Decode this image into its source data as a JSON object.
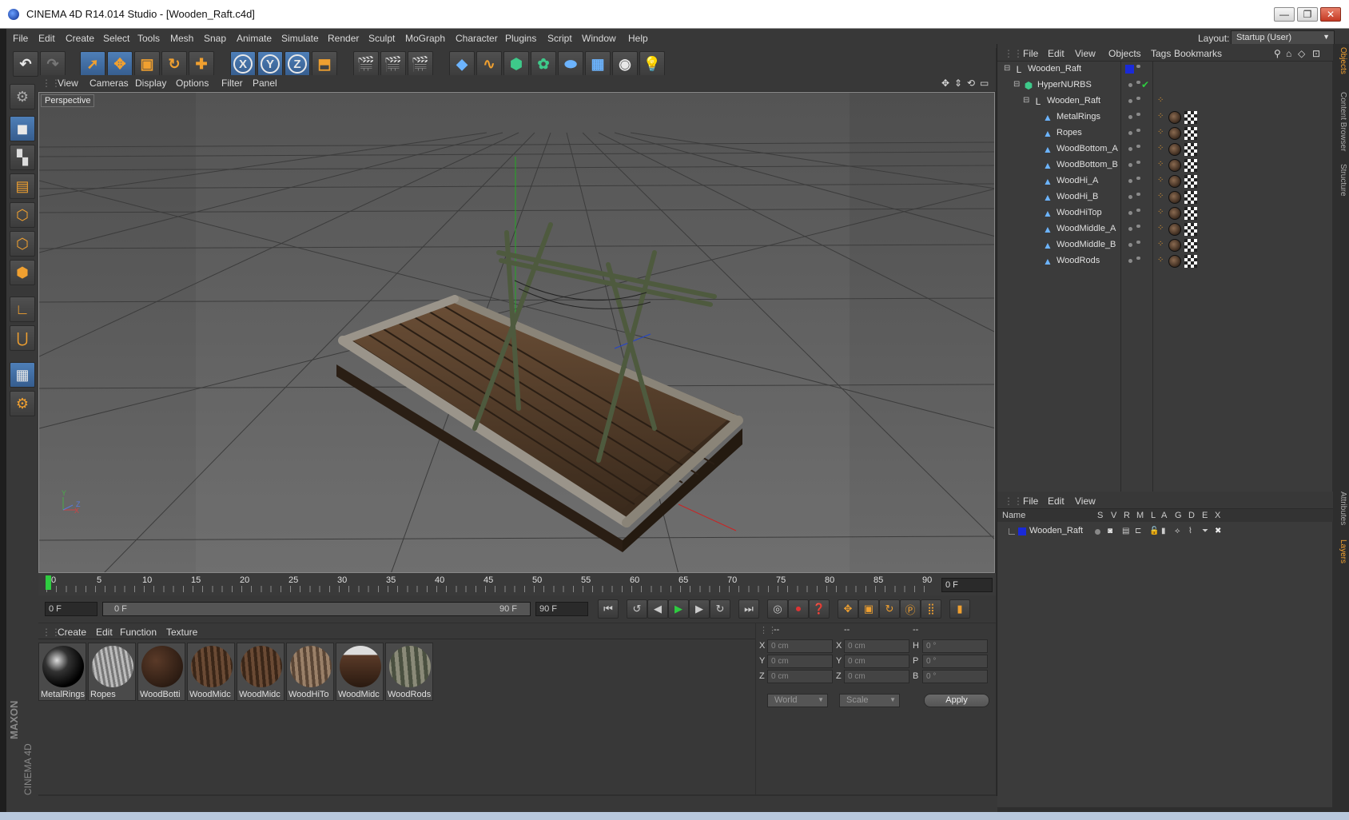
{
  "window": {
    "title": "CINEMA 4D R14.014 Studio - [Wooden_Raft.c4d]",
    "minimize_glyph": "—",
    "restore_glyph": "❐",
    "close_glyph": "✕"
  },
  "menubar": {
    "items": [
      "File",
      "Edit",
      "Create",
      "Select",
      "Tools",
      "Mesh",
      "Snap",
      "Animate",
      "Simulate",
      "Render",
      "Sculpt",
      "MoGraph",
      "Character",
      "Plugins",
      "Script",
      "Window",
      "Help"
    ],
    "layout_label": "Layout:",
    "layout_value": "Startup (User)"
  },
  "toolbar": {
    "undo": "↶",
    "redo": "↷",
    "x_axis": "X",
    "y_axis": "Y",
    "z_axis": "Z"
  },
  "viewport": {
    "menu": [
      "View",
      "Cameras",
      "Display",
      "Options",
      "Filter",
      "Panel"
    ],
    "label": "Perspective",
    "axis_x": "X",
    "axis_y": "Y",
    "axis_z": "Z"
  },
  "timeline": {
    "ticks": [
      "0",
      "5",
      "10",
      "15",
      "20",
      "25",
      "30",
      "35",
      "40",
      "45",
      "50",
      "55",
      "60",
      "65",
      "70",
      "75",
      "80",
      "85",
      "90"
    ],
    "current_frame": "0 F"
  },
  "transport": {
    "start_field": "0 F",
    "range_start": "0 F",
    "range_end": "90 F",
    "end_field": "90 F"
  },
  "material_manager": {
    "menu": [
      "Create",
      "Edit",
      "Function",
      "Texture"
    ],
    "materials": [
      {
        "name": "MetalRings",
        "color": "dark-metal"
      },
      {
        "name": "Ropes",
        "color": "grey"
      },
      {
        "name": "WoodBottom_A",
        "color": "dark-brown"
      },
      {
        "name": "WoodMiddle_A",
        "color": "brown"
      },
      {
        "name": "WoodMiddle_B",
        "color": "brown"
      },
      {
        "name": "WoodHiTop",
        "color": "light-brown"
      },
      {
        "name": "WoodMiddle_C",
        "color": "brown"
      },
      {
        "name": "WoodRods",
        "color": "grey-green"
      }
    ],
    "visible_names": [
      "MetalRings",
      "Ropes",
      "WoodBotti",
      "WoodMidc",
      "WoodMidc",
      "WoodHiTo",
      "WoodMidc",
      "WoodRods"
    ]
  },
  "coordinates": {
    "header": [
      "--",
      "--",
      "--"
    ],
    "rows": [
      {
        "l1": "X",
        "v1": "0 cm",
        "l2": "X",
        "v2": "0 cm",
        "l3": "H",
        "v3": "0 °"
      },
      {
        "l1": "Y",
        "v1": "0 cm",
        "l2": "Y",
        "v2": "0 cm",
        "l3": "P",
        "v3": "0 °"
      },
      {
        "l1": "Z",
        "v1": "0 cm",
        "l2": "Z",
        "v2": "0 cm",
        "l3": "B",
        "v3": "0 °"
      }
    ],
    "space": "World",
    "mode": "Scale",
    "apply": "Apply"
  },
  "object_manager": {
    "menu": [
      "File",
      "Edit",
      "View",
      "Objects",
      "Tags",
      "Bookmarks"
    ],
    "objects": [
      {
        "name": "Wooden_Raft",
        "level": 0,
        "icon": "null-icon"
      },
      {
        "name": "HyperNURBS",
        "level": 1,
        "icon": "hypernurbs-icon"
      },
      {
        "name": "Wooden_Raft",
        "level": 2,
        "icon": "null-icon"
      },
      {
        "name": "MetalRings",
        "level": 3,
        "icon": "polygon-icon"
      },
      {
        "name": "Ropes",
        "level": 3,
        "icon": "polygon-icon"
      },
      {
        "name": "WoodBottom_A",
        "level": 3,
        "icon": "polygon-icon"
      },
      {
        "name": "WoodBottom_B",
        "level": 3,
        "icon": "polygon-icon"
      },
      {
        "name": "WoodHi_A",
        "level": 3,
        "icon": "polygon-icon"
      },
      {
        "name": "WoodHi_B",
        "level": 3,
        "icon": "polygon-icon"
      },
      {
        "name": "WoodHiTop",
        "level": 3,
        "icon": "polygon-icon"
      },
      {
        "name": "WoodMiddle_A",
        "level": 3,
        "icon": "polygon-icon"
      },
      {
        "name": "WoodMiddle_B",
        "level": 3,
        "icon": "polygon-icon"
      },
      {
        "name": "WoodRods",
        "level": 3,
        "icon": "polygon-icon"
      }
    ],
    "check_glyph": "✔"
  },
  "layer_manager": {
    "menu": [
      "File",
      "Edit",
      "View"
    ],
    "columns": [
      "Name",
      "S",
      "V",
      "R",
      "M",
      "L",
      "A",
      "G",
      "D",
      "E",
      "X"
    ],
    "layers": [
      {
        "name": "Wooden_Raft",
        "color": "#1a2ad8"
      }
    ]
  },
  "side_tabs": [
    "Objects",
    "Content Browser",
    "Structure",
    "Attributes",
    "Layers"
  ],
  "logo": {
    "line1": "MAXON",
    "line2": "CINEMA 4D"
  },
  "colors": {
    "layer_blue": "#1a2ad8",
    "play_green": "#2ecc40",
    "accent_blue": "#4e7fb8",
    "tool_orange": "#f0a030"
  }
}
